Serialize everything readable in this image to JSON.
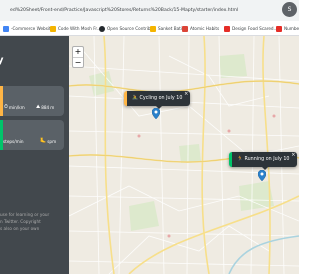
{
  "browser": {
    "address_text": "ed%20Sheet/Front-end/Practice/Javascript%20Stores/Returns%20Back/15-Mapty/starter/index.html",
    "profile_initial": "S"
  },
  "bookmarks": [
    {
      "label": "-Commerce Website",
      "icon": "#4285f4"
    },
    {
      "label": "Code With Mosh Fr...",
      "icon": "#f4b400"
    },
    {
      "label": "Open Source Contrib...",
      "icon": "#24292e"
    },
    {
      "label": "Sanket Batia",
      "icon": "#f4b400"
    },
    {
      "label": "Atomic Habits",
      "icon": "#db4437"
    },
    {
      "label": "Design Food Scared...",
      "icon": "#e52d27"
    },
    {
      "label": "Number T...",
      "icon": "#e52d27"
    }
  ],
  "sidebar": {
    "logo_fragment": "y",
    "workouts": [
      {
        "type": "cycling",
        "accent": "#ffb545",
        "stats": [
          {
            "icon": "⏱",
            "value": "",
            "unit": "min/km"
          },
          {
            "icon": "⛰",
            "value": "884",
            "unit": "m"
          }
        ]
      },
      {
        "type": "running",
        "accent": "#00c46a",
        "stats": [
          {
            "icon": "",
            "value": "",
            "unit": "steps/min"
          },
          {
            "icon": "🦶",
            "value": "",
            "unit": "spm"
          }
        ]
      }
    ],
    "copyright_lines": [
      "use for learning or your",
      "n Twitter. Copyright",
      "s also on your own"
    ]
  },
  "map": {
    "zoom_in": "+",
    "zoom_out": "−",
    "popups": [
      {
        "type": "cycling",
        "icon": "🚴",
        "text": "Cycling on July 10",
        "accent": "#ffb545"
      },
      {
        "type": "running",
        "icon": "🏃",
        "text": "Running on July 10",
        "accent": "#00c46a"
      }
    ],
    "close_symbol": "×"
  }
}
